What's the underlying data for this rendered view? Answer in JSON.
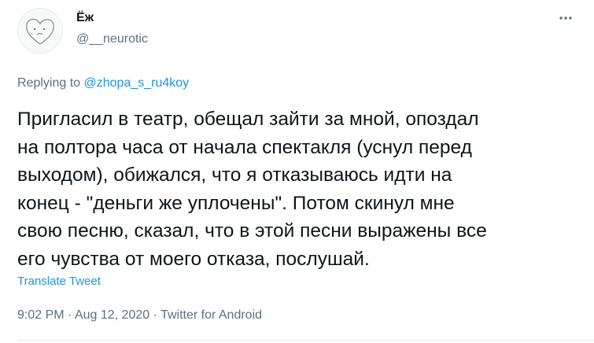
{
  "author": {
    "display_name": "Ёж",
    "handle": "@__neurotic",
    "avatar_icon": "doodle-heart-avatar"
  },
  "reply": {
    "prefix": "Replying to ",
    "mention": "@zhopa_s_ru4koy"
  },
  "tweet": {
    "text": "Пригласил в театр, обещал зайти за мной, опоздал\nна полтора часа от начала спектакля (уснул перед\nвыходом), обижался, что я отказываюсь идти на\nконец - \"деньги же уплочены\". Потом скинул мне\nсвою песню, сказал, что в этой песни выражены все\nего чувства от моего отказа, послушай.",
    "translate_label": "Translate Tweet"
  },
  "meta": {
    "time": "9:02 PM",
    "separator": " · ",
    "date": "Aug 12, 2020",
    "source": "Twitter for Android"
  },
  "colors": {
    "text": "#0f1419",
    "secondary": "#5b7083",
    "link": "#1b95e0"
  },
  "icons": {
    "more": "more-horizontal-icon"
  }
}
